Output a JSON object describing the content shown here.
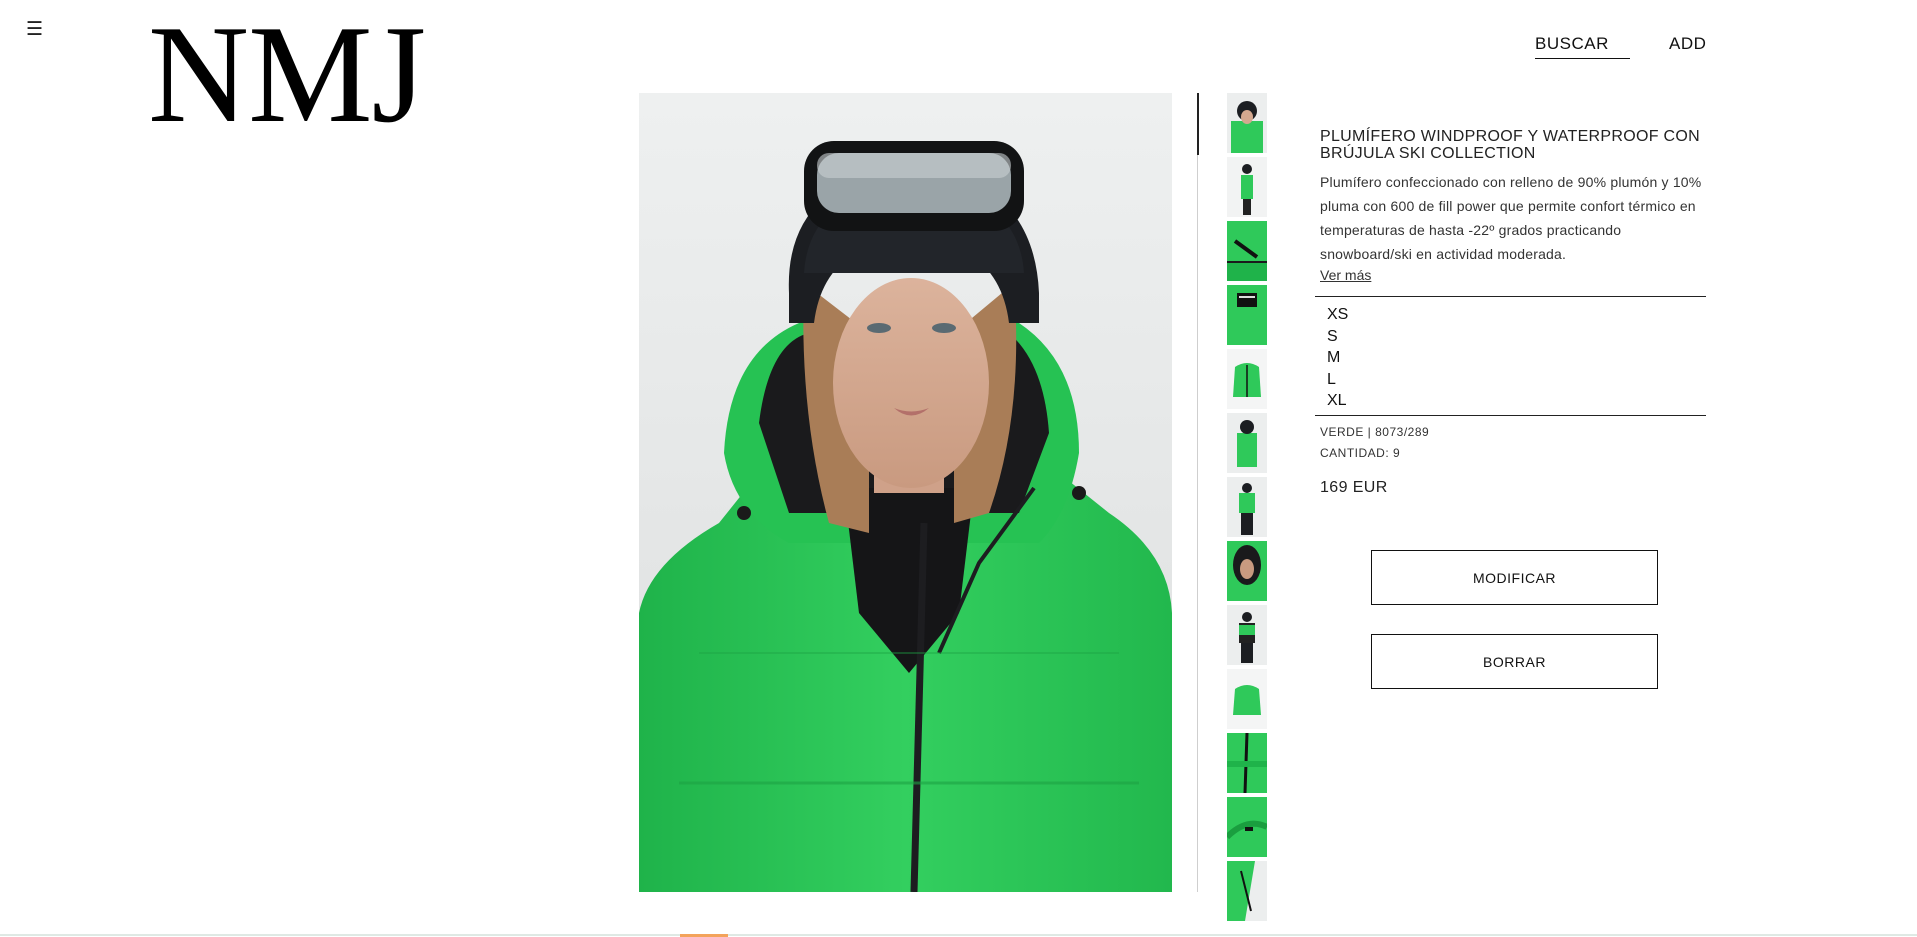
{
  "header": {
    "menu_icon": "☰",
    "logo": "NMJ",
    "search_label": "BUSCAR",
    "add_label": "ADD"
  },
  "product": {
    "title": "PLUMÍFERO WINDPROOF Y WATERPROOF CON BRÚJULA SKI COLLECTION",
    "description": "Plumífero confeccionado con relleno de 90% plumón y 10% pluma con 600 de fill power que permite confort térmico en temperaturas de hasta -22º grados practicando snowboard/ski en actividad moderada.",
    "more_link": "Ver más",
    "sizes": [
      "XS",
      "S",
      "M",
      "L",
      "XL"
    ],
    "color_line": "VERDE | 8073/289",
    "quantity_line": "CANTIDAD: 9",
    "price": "169 EUR",
    "modify_label": "MODIFICAR",
    "delete_label": "BORRAR",
    "thumbnail_count": 13
  },
  "colors": {
    "jacket_green": "#2fc95a",
    "accent_bottom": "#f3a35b"
  }
}
